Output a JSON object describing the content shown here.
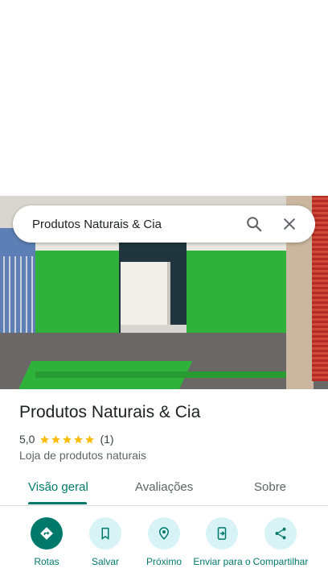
{
  "search": {
    "query": "Produtos Naturais & Cia"
  },
  "place": {
    "name": "Produtos Naturais & Cia",
    "rating": "5,0",
    "stars": 5,
    "review_count": "(1)",
    "category": "Loja de produtos naturais"
  },
  "tabs": [
    {
      "label": "Visão geral",
      "active": true
    },
    {
      "label": "Avaliações",
      "active": false
    },
    {
      "label": "Sobre",
      "active": false
    }
  ],
  "actions": [
    {
      "label": "Rotas",
      "icon": "directions-icon"
    },
    {
      "label": "Salvar",
      "icon": "bookmark-icon"
    },
    {
      "label": "Próximo",
      "icon": "nearby-icon"
    },
    {
      "label": "Enviar para o",
      "icon": "send-to-phone-icon"
    },
    {
      "label": "Compartilhar",
      "icon": "share-icon"
    }
  ],
  "colors": {
    "accent": "#00796b",
    "action_bg": "#d8f3f6",
    "star": "#fbbc04",
    "storefront_green": "#2fb23a"
  }
}
